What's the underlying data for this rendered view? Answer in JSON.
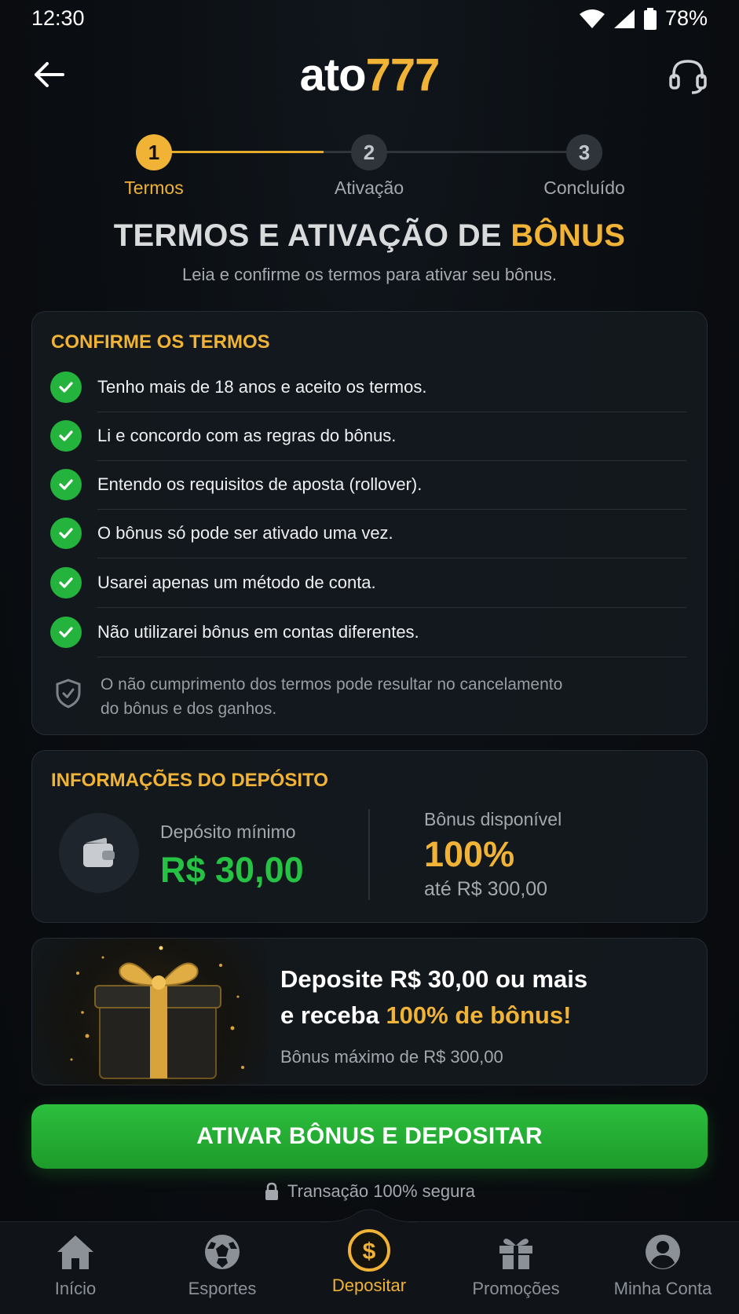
{
  "status_bar": {
    "time": "12:30",
    "battery": "78%"
  },
  "header": {
    "logo_part1": "ato",
    "logo_part2": "777"
  },
  "stepper": {
    "steps": [
      {
        "number": "1",
        "label": "Termos",
        "state": "active"
      },
      {
        "number": "2",
        "label": "Ativação",
        "state": "inactive"
      },
      {
        "number": "3",
        "label": "Concluído",
        "state": "inactive"
      }
    ]
  },
  "page": {
    "title_part1": "TERMOS E ATIVAÇÃO DE ",
    "title_part2": "BÔNUS",
    "subtitle": "Leia e confirme os termos para ativar seu bônus."
  },
  "terms_card": {
    "title": "CONFIRME OS TERMOS",
    "items": [
      "Tenho mais de 18 anos e aceito os termos.",
      "Li e concordo com as regras do bônus.",
      "Entendo os requisitos de aposta (rollover).",
      "O bônus só pode ser ativado uma vez.",
      "Usarei apenas um método de conta.",
      "Não utilizarei bônus em contas diferentes."
    ],
    "warning_line1": "O não cumprimento dos termos pode resultar no cancelamento",
    "warning_line2": "do bônus e dos ganhos."
  },
  "deposit_card": {
    "title": "INFORMAÇÕES DO DEPÓSITO",
    "min_label": "Depósito mínimo",
    "min_value": "R$ 30,00",
    "bonus_label": "Bônus disponível",
    "bonus_value": "100%",
    "bonus_cap": "até R$ 300,00"
  },
  "promo_card": {
    "line1": "Deposite R$ 30,00 ou mais",
    "line2_prefix": "e receba ",
    "line2_highlight": "100% de bônus!",
    "note": "Bônus máximo de R$ 300,00"
  },
  "cta": {
    "label": "ATIVAR BÔNUS E DEPOSITAR"
  },
  "secure_note": "Transação 100% segura",
  "bottom_nav": [
    {
      "label": "Início",
      "icon": "home-icon",
      "active": false
    },
    {
      "label": "Esportes",
      "icon": "soccer-ball-icon",
      "active": false
    },
    {
      "label": "Depositar",
      "icon": "dollar-coin-icon",
      "active": true
    },
    {
      "label": "Promoções",
      "icon": "gift-icon",
      "active": false
    },
    {
      "label": "Minha Conta",
      "icon": "user-icon",
      "active": false
    }
  ],
  "colors": {
    "accent": "#f0b336",
    "success": "#25c244",
    "background": "#0a0d11"
  }
}
